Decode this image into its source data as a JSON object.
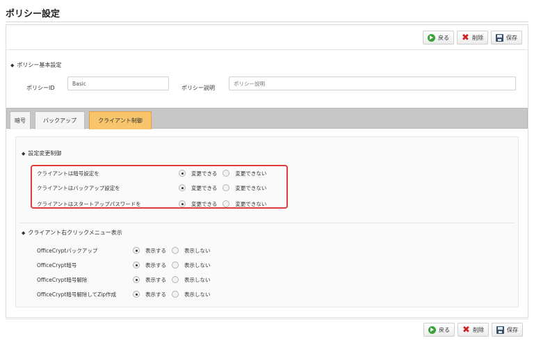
{
  "page": {
    "title": "ポリシー設定"
  },
  "toolbar": {
    "back": "戻る",
    "delete": "削除",
    "save": "保存"
  },
  "basic": {
    "section": "ポリシー基本設定",
    "id_label": "ポリシーID",
    "id_value": "Basic",
    "desc_label": "ポリシー説明",
    "desc_placeholder": "ポリシー説明"
  },
  "tabs": [
    {
      "label": "暗号",
      "active": false
    },
    {
      "label": "バックアップ",
      "active": false
    },
    {
      "label": "クライアント制御",
      "active": true
    }
  ],
  "change_control": {
    "section": "設定変更制御",
    "yes_label": "変更できる",
    "no_label": "変更できない",
    "rows": [
      {
        "label": "クライアントは暗号設定を",
        "value": "変更できる"
      },
      {
        "label": "クライアントはバックアップ設定を",
        "value": "変更できる"
      },
      {
        "label": "クライアントはスタートアップパスワードを",
        "value": "変更できる"
      }
    ]
  },
  "context_menu": {
    "section": "クライアント右クリックメニュー表示",
    "yes_label": "表示する",
    "no_label": "表示しない",
    "rows": [
      {
        "label": "OfficeCryptバックアップ",
        "value": "表示する"
      },
      {
        "label": "OfficeCrypt暗号",
        "value": "表示する"
      },
      {
        "label": "OfficeCrypt暗号解除",
        "value": "表示する"
      },
      {
        "label": "OfficeCrypt暗号解除してZip作成",
        "value": "表示する"
      }
    ]
  },
  "colors": {
    "accent_tab": "#f8c46c",
    "highlight": "#e23b3b"
  }
}
